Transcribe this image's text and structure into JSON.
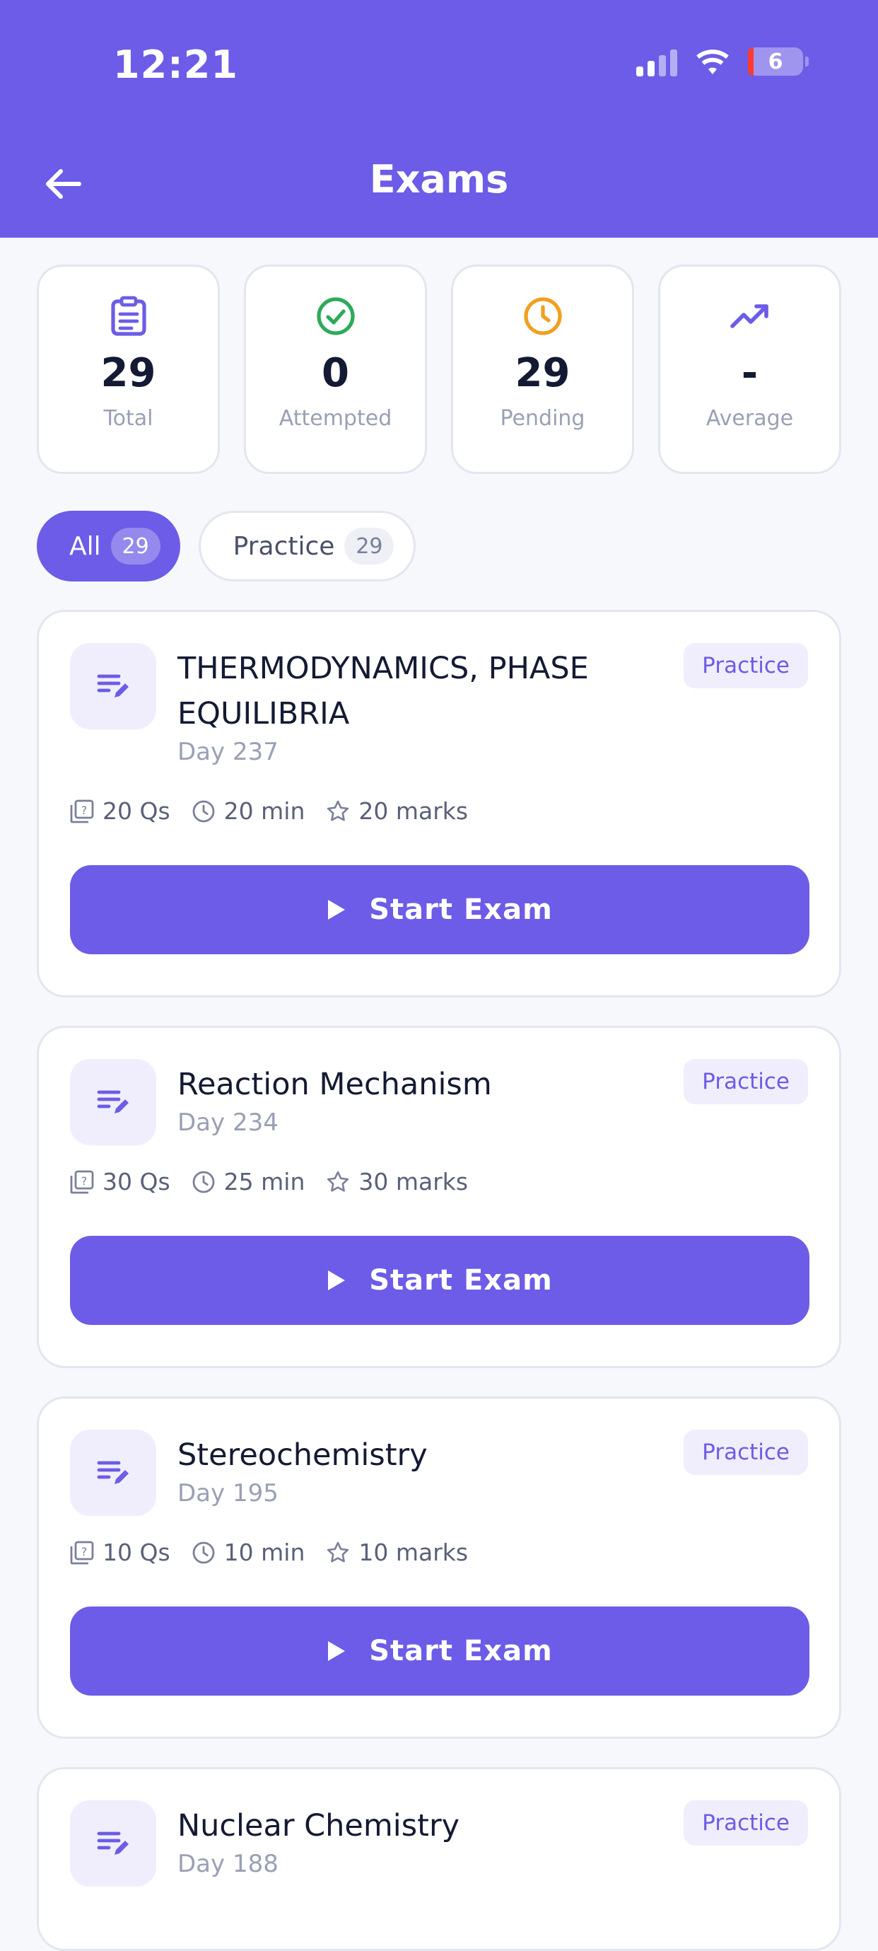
{
  "status_bar": {
    "time": "12:21",
    "battery": "6"
  },
  "header": {
    "title": "Exams"
  },
  "stats": [
    {
      "value": "29",
      "label": "Total"
    },
    {
      "value": "0",
      "label": "Attempted"
    },
    {
      "value": "29",
      "label": "Pending"
    },
    {
      "value": "-",
      "label": "Average"
    }
  ],
  "filters": [
    {
      "label": "All",
      "count": "29",
      "active": true
    },
    {
      "label": "Practice",
      "count": "29",
      "active": false
    }
  ],
  "start_label": "Start Exam",
  "exams": [
    {
      "title": "THERMODYNAMICS, PHASE EQUILIBRIA",
      "day": "Day 237",
      "tag": "Practice",
      "questions": "20 Qs",
      "duration": "20 min",
      "marks": "20 marks"
    },
    {
      "title": "Reaction Mechanism",
      "day": "Day 234",
      "tag": "Practice",
      "questions": "30 Qs",
      "duration": "25 min",
      "marks": "30 marks"
    },
    {
      "title": "Stereochemistry",
      "day": "Day 195",
      "tag": "Practice",
      "questions": "10 Qs",
      "duration": "10 min",
      "marks": "10 marks"
    },
    {
      "title": "Nuclear Chemistry",
      "day": "Day 188",
      "tag": "Practice"
    }
  ],
  "colors": {
    "primary": "#6c5ce7",
    "success": "#2eaa5a",
    "warning": "#f0a020"
  }
}
